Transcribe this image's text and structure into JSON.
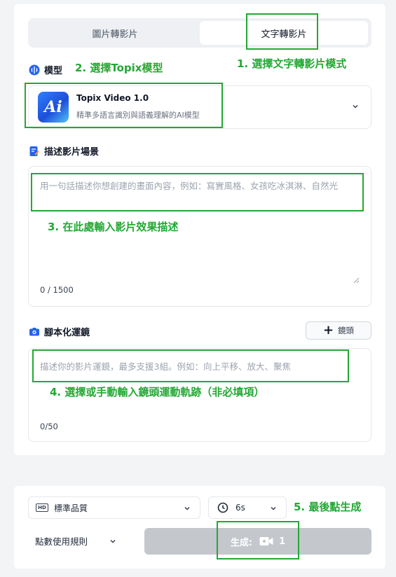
{
  "tabs": {
    "image_to_video": "圖片轉影片",
    "text_to_video": "文字轉影片"
  },
  "model": {
    "label": "模型",
    "name": "Topix Video 1.0",
    "description": "精準多語言識別與語義理解的AI模型",
    "logo_text": "Ai"
  },
  "scene": {
    "label": "描述影片場景",
    "placeholder": "用一句話描述你想創建的畫面內容，例如：寫實風格、女孩吃冰淇淋、自然光",
    "counter": "0 / 1500"
  },
  "camera": {
    "label": "腳本化運鏡",
    "add_button": "鏡頭",
    "placeholder": "描述你的影片運鏡，最多支援3組。例如：向上平移、放大、聚焦",
    "counter": "0/50"
  },
  "settings": {
    "quality": "標準品質",
    "quality_icon": "HD",
    "duration": "6s",
    "rules": "點數使用規則",
    "generate_label": "生成:",
    "generate_cost": "1"
  },
  "annotations": {
    "step1": "1. 選擇文字轉影片模式",
    "step2": "2. 選擇Topix模型",
    "step3": "3. 在此處輸入影片效果描述",
    "step4": "4. 選擇或手動輸入鏡頭運動軌跡（非必填項）",
    "step5": "5. 最後點生成"
  },
  "colors": {
    "annotation": "#22a833",
    "generate_disabled": "#c4c7cc",
    "accent": "#2563eb"
  }
}
